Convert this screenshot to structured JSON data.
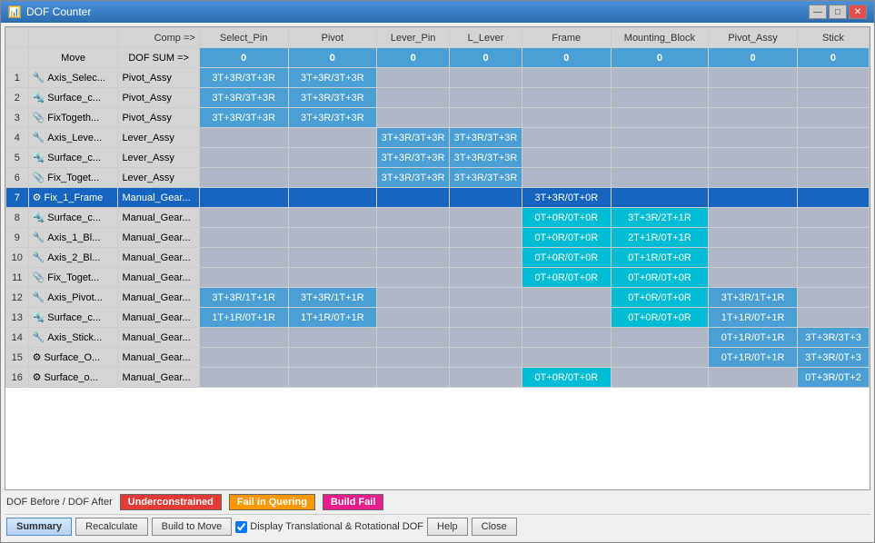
{
  "window": {
    "title": "DOF Counter",
    "icon": "table-icon"
  },
  "title_controls": {
    "minimize": "—",
    "maximize": "□",
    "close": "✕"
  },
  "table": {
    "header1": {
      "comp_label": "Comp =>",
      "select_pin": "Select_Pin",
      "pivot": "Pivot",
      "lever_pin": "Lever_Pin",
      "l_lever": "L_Lever",
      "frame": "Frame",
      "mounting_block": "Mounting_Block",
      "pivot_assy": "Pivot_Assy",
      "stick": "Stick"
    },
    "header2": {
      "move_label": "Move",
      "dof_sum_label": "DOF SUM =>",
      "select_pin": "0",
      "pivot": "0",
      "lever_pin": "0",
      "l_lever": "0",
      "frame": "0",
      "mounting_block": "0",
      "pivot_assy": "0",
      "stick": "0"
    },
    "rows": [
      {
        "num": "1",
        "icon": "🔧",
        "move": "Axis_Selec...",
        "comp": "Pivot_Assy",
        "select_pin": "3T+3R/3T+3R",
        "pivot": "3T+3R/3T+3R",
        "lever_pin": "",
        "l_lever": "",
        "frame": "",
        "mounting_block": "",
        "pivot_assy": "",
        "stick": ""
      },
      {
        "num": "2",
        "icon": "🔩",
        "move": "Surface_c...",
        "comp": "Pivot_Assy",
        "select_pin": "3T+3R/3T+3R",
        "pivot": "3T+3R/3T+3R",
        "lever_pin": "",
        "l_lever": "",
        "frame": "",
        "mounting_block": "",
        "pivot_assy": "",
        "stick": ""
      },
      {
        "num": "3",
        "icon": "📎",
        "move": "FixTogeth...",
        "comp": "Pivot_Assy",
        "select_pin": "3T+3R/3T+3R",
        "pivot": "3T+3R/3T+3R",
        "lever_pin": "",
        "l_lever": "",
        "frame": "",
        "mounting_block": "",
        "pivot_assy": "",
        "stick": ""
      },
      {
        "num": "4",
        "icon": "🔧",
        "move": "Axis_Leve...",
        "comp": "Lever_Assy",
        "select_pin": "",
        "pivot": "",
        "lever_pin": "3T+3R/3T+3R",
        "l_lever": "3T+3R/3T+3R",
        "frame": "",
        "mounting_block": "",
        "pivot_assy": "",
        "stick": ""
      },
      {
        "num": "5",
        "icon": "🔩",
        "move": "Surface_c...",
        "comp": "Lever_Assy",
        "select_pin": "",
        "pivot": "",
        "lever_pin": "3T+3R/3T+3R",
        "l_lever": "3T+3R/3T+3R",
        "frame": "",
        "mounting_block": "",
        "pivot_assy": "",
        "stick": ""
      },
      {
        "num": "6",
        "icon": "📎",
        "move": "Fix_Toget...",
        "comp": "Lever_Assy",
        "select_pin": "",
        "pivot": "",
        "lever_pin": "3T+3R/3T+3R",
        "l_lever": "3T+3R/3T+3R",
        "frame": "",
        "mounting_block": "",
        "pivot_assy": "",
        "stick": ""
      },
      {
        "num": "7",
        "icon": "⚙",
        "move": "Fix_1_Frame",
        "comp": "Manual_Gear...",
        "select_pin": "",
        "pivot": "",
        "lever_pin": "",
        "l_lever": "",
        "frame": "3T+3R/0T+0R",
        "mounting_block": "",
        "pivot_assy": "",
        "stick": "",
        "selected": true
      },
      {
        "num": "8",
        "icon": "🔩",
        "move": "Surface_c...",
        "comp": "Manual_Gear...",
        "select_pin": "",
        "pivot": "",
        "lever_pin": "",
        "l_lever": "",
        "frame": "0T+0R/0T+0R",
        "mounting_block": "3T+3R/2T+1R",
        "pivot_assy": "",
        "stick": ""
      },
      {
        "num": "9",
        "icon": "🔧",
        "move": "Axis_1_Bl...",
        "comp": "Manual_Gear...",
        "select_pin": "",
        "pivot": "",
        "lever_pin": "",
        "l_lever": "",
        "frame": "0T+0R/0T+0R",
        "mounting_block": "2T+1R/0T+1R",
        "pivot_assy": "",
        "stick": ""
      },
      {
        "num": "10",
        "icon": "🔧",
        "move": "Axis_2_Bl...",
        "comp": "Manual_Gear...",
        "select_pin": "",
        "pivot": "",
        "lever_pin": "",
        "l_lever": "",
        "frame": "0T+0R/0T+0R",
        "mounting_block": "0T+1R/0T+0R",
        "pivot_assy": "",
        "stick": ""
      },
      {
        "num": "11",
        "icon": "📎",
        "move": "Fix_Toget...",
        "comp": "Manual_Gear...",
        "select_pin": "",
        "pivot": "",
        "lever_pin": "",
        "l_lever": "",
        "frame": "0T+0R/0T+0R",
        "mounting_block": "0T+0R/0T+0R",
        "pivot_assy": "",
        "stick": ""
      },
      {
        "num": "12",
        "icon": "🔧",
        "move": "Axis_Pivot...",
        "comp": "Manual_Gear...",
        "select_pin": "3T+3R/1T+1R",
        "pivot": "3T+3R/1T+1R",
        "lever_pin": "",
        "l_lever": "",
        "frame": "",
        "mounting_block": "0T+0R/0T+0R",
        "pivot_assy": "3T+3R/1T+1R",
        "stick": ""
      },
      {
        "num": "13",
        "icon": "🔩",
        "move": "Surface_c...",
        "comp": "Manual_Gear...",
        "select_pin": "1T+1R/0T+1R",
        "pivot": "1T+1R/0T+1R",
        "lever_pin": "",
        "l_lever": "",
        "frame": "",
        "mounting_block": "0T+0R/0T+0R",
        "pivot_assy": "1T+1R/0T+1R",
        "stick": ""
      },
      {
        "num": "14",
        "icon": "🔧",
        "move": "Axis_Stick...",
        "comp": "Manual_Gear...",
        "select_pin": "",
        "pivot": "",
        "lever_pin": "",
        "l_lever": "",
        "frame": "",
        "mounting_block": "",
        "pivot_assy": "0T+1R/0T+1R",
        "stick": "3T+3R/3T+3"
      },
      {
        "num": "15",
        "icon": "⚙",
        "move": "Surface_O...",
        "comp": "Manual_Gear...",
        "select_pin": "",
        "pivot": "",
        "lever_pin": "",
        "l_lever": "",
        "frame": "",
        "mounting_block": "",
        "pivot_assy": "0T+1R/0T+1R",
        "stick": "3T+3R/0T+3"
      },
      {
        "num": "16",
        "icon": "⚙",
        "move": "Surface_o...",
        "comp": "Manual_Gear...",
        "select_pin": "",
        "pivot": "",
        "lever_pin": "",
        "l_lever": "",
        "frame": "0T+0R/0T+0R",
        "mounting_block": "",
        "pivot_assy": "",
        "stick": "0T+3R/0T+2"
      }
    ]
  },
  "status_bar": {
    "label": "DOF Before / DOF After",
    "underconstrained": "Underconstrained",
    "fail_in_quering": "Fail in Quering",
    "build_fail": "Build Fail"
  },
  "bottom_bar": {
    "summary": "Summary",
    "recalculate": "Recalculate",
    "build_to_move": "Build to Move",
    "checkbox_label": "Display Translational & Rotational DOF",
    "help": "Help",
    "close": "Close"
  }
}
